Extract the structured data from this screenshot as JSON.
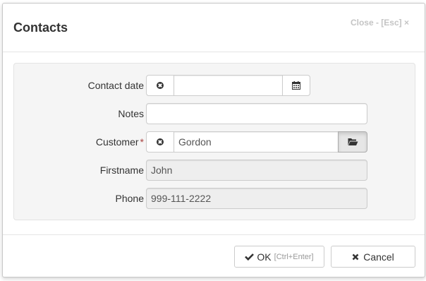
{
  "dialog": {
    "title": "Contacts",
    "close_label": "Close - [Esc] ×"
  },
  "form": {
    "contact_date": {
      "label": "Contact date",
      "value": ""
    },
    "notes": {
      "label": "Notes",
      "value": ""
    },
    "customer": {
      "label": "Customer",
      "required_marker": "*",
      "value": "Gordon"
    },
    "firstname": {
      "label": "Firstname",
      "value": "John"
    },
    "phone": {
      "label": "Phone",
      "value": "999-111-2222"
    }
  },
  "footer": {
    "ok_label": "OK",
    "ok_hint": "[Ctrl+Enter]",
    "cancel_label": "Cancel"
  },
  "icons": {
    "clear": "times-circle-icon",
    "calendar": "calendar-icon",
    "browse": "folder-open-icon",
    "ok": "check-icon",
    "cancel": "times-icon"
  },
  "colors": {
    "required": "#a94442",
    "panel": "#f5f5f5",
    "readonly": "#eeeeee"
  }
}
